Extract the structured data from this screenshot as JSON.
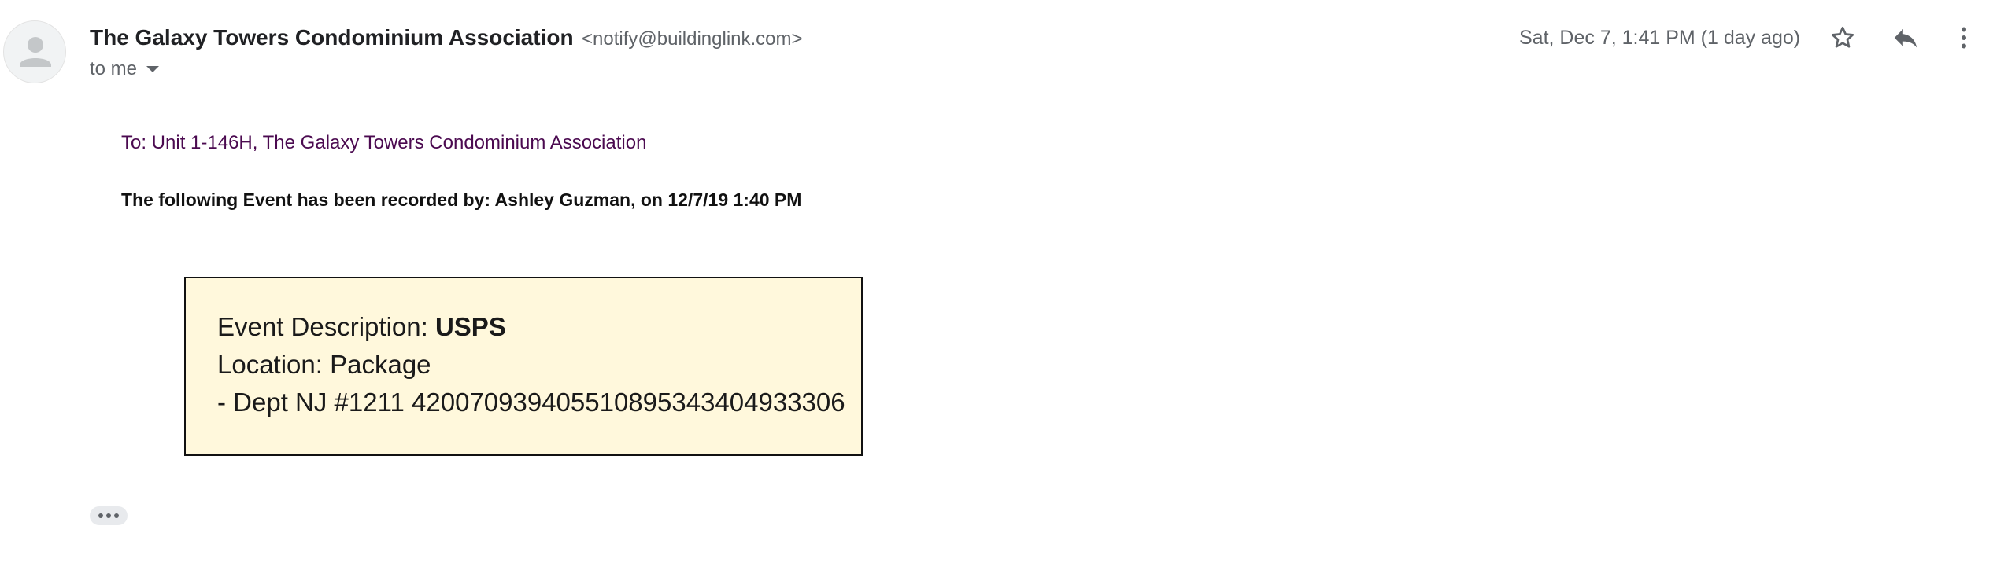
{
  "header": {
    "sender_name": "The Galaxy Towers Condominium Association",
    "sender_email": "<notify@buildinglink.com>",
    "recipient": "to me",
    "date": "Sat, Dec 7, 1:41 PM (1 day ago)"
  },
  "icons": {
    "avatar": "person-icon",
    "star": "star-icon",
    "reply": "reply-icon",
    "more": "more-vert-icon",
    "expand": "ellipsis-icon"
  },
  "body": {
    "to_line": "To: Unit 1-146H, The Galaxy Towers Condominium Association",
    "recorded_line": "The following Event has been recorded  by: Ashley Guzman, on 12/7/19 1:40 PM",
    "event": {
      "description_label": "Event Description: ",
      "description_value": "USPS",
      "location": "Location: Package",
      "details": "- Dept NJ #1211 420070939405510895343404933306"
    }
  },
  "colors": {
    "link_purple": "#4b0a50",
    "event_box_bg": "#fff8dc",
    "muted_text": "#5f6368"
  }
}
